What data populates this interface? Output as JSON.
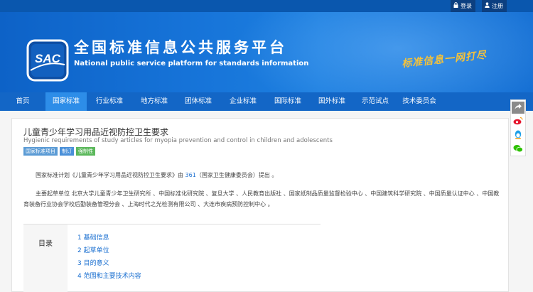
{
  "topbar": {
    "login_label": "登录",
    "register_label": "注册"
  },
  "header": {
    "logo_text": "SAC",
    "title_cn": "全国标准信息公共服务平台",
    "title_en": "National public service platform  for standards information",
    "slogan": "标准信息一网打尽"
  },
  "nav": {
    "items": [
      {
        "label": "首页"
      },
      {
        "label": "国家标准"
      },
      {
        "label": "行业标准"
      },
      {
        "label": "地方标准"
      },
      {
        "label": "团体标准"
      },
      {
        "label": "企业标准"
      },
      {
        "label": "国际标准"
      },
      {
        "label": "国外标准"
      },
      {
        "label": "示范试点"
      },
      {
        "label": "技术委员会"
      }
    ],
    "active_index": 1
  },
  "doc": {
    "title": "儿童青少年学习用品近视防控卫生要求",
    "title_en": "Hygienic requirements of study articles for myopia prevention and control in children and adolescents",
    "tags": [
      {
        "label": "国家标准项目",
        "color": "#5b9bd5"
      },
      {
        "label": "制订",
        "color": "#4a90d9"
      },
      {
        "label": "强制性",
        "color": "#5cb85c"
      }
    ],
    "plan_prefix": "国家标准计划《儿童青少年学习用品近视防控卫生要求》由 ",
    "plan_number": "361",
    "plan_suffix": "（国家卫生健康委员会）提出 。",
    "drafters": "主要起草单位 北京大学儿童青少年卫生研究所 、中国标准化研究院 、复旦大学 、人民教育出版社 、国家纸制品质量监督检验中心 、中国建筑科学研究院 、中国质量认证中心 、中国教育装备行业协会学校后勤装备管理分会 、上海时代之光检测有限公司 、大连市疾病预防控制中心 。"
  },
  "toc": {
    "label": "目录",
    "items": [
      "1  基础信息",
      "2  起草单位",
      "3  目的意义",
      "4  范围和主要技术内容"
    ]
  },
  "colors": {
    "nav_bg": "#1366c6",
    "nav_active": "#2d8de8",
    "link": "#1a6fd0"
  }
}
